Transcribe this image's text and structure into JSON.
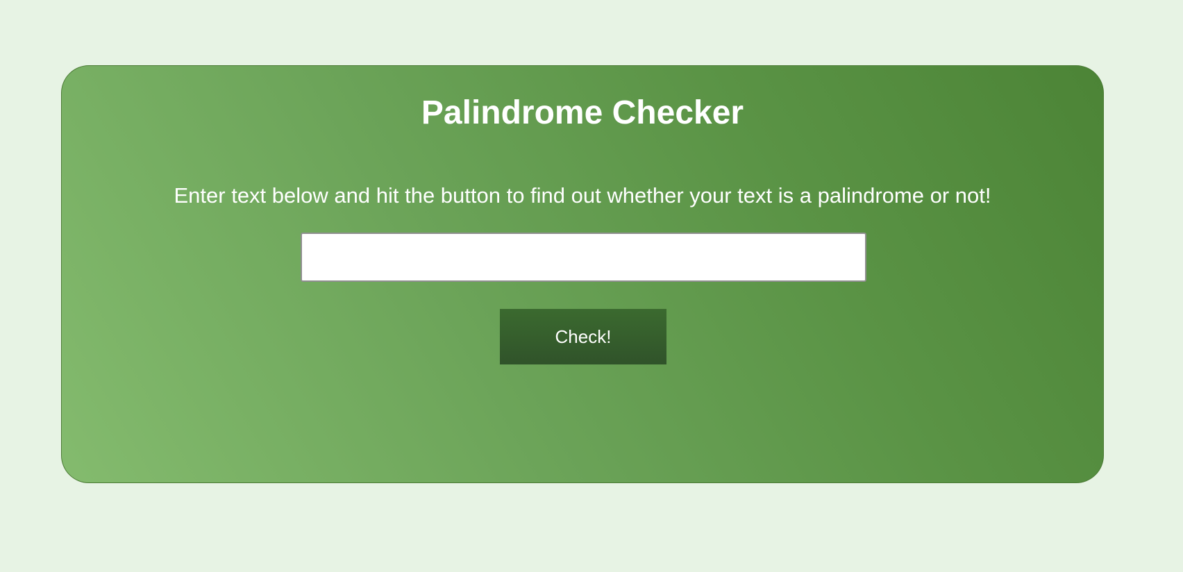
{
  "checker": {
    "title": "Palindrome Checker",
    "instructions": "Enter text below and hit the button to find out whether your text is a palindrome or not!",
    "input_value": "",
    "input_placeholder": "",
    "button_label": "Check!"
  },
  "colors": {
    "page_background": "#e7f3e4",
    "card_gradient_light": "#84bb6e",
    "card_gradient_dark": "#4c8436",
    "button_background": "#3b6a2f",
    "text": "#ffffff"
  }
}
